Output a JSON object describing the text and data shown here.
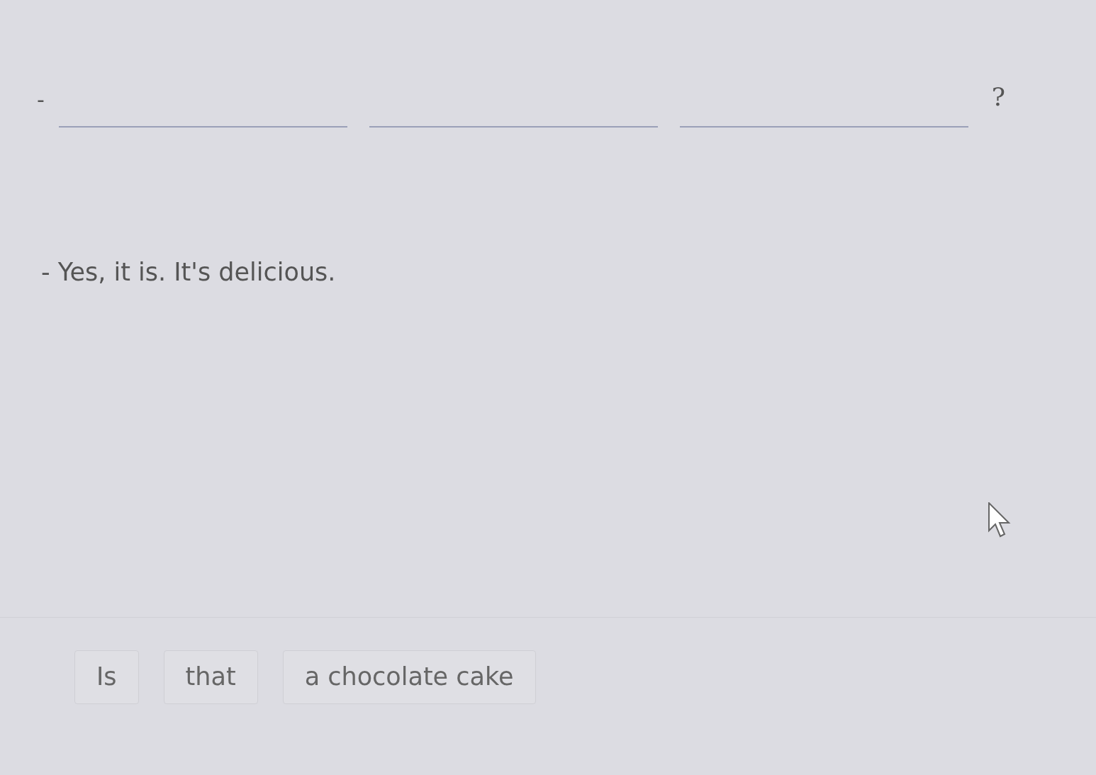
{
  "question": {
    "parts": [
      {
        "kind": "dash",
        "text": "-"
      },
      {
        "kind": "blank"
      },
      {
        "kind": "blank"
      },
      {
        "kind": "blank"
      },
      {
        "kind": "text",
        "text": "?"
      }
    ]
  },
  "answer": {
    "text": "- Yes, it is. It's delicious."
  },
  "word_bank": [
    {
      "text": "Is"
    },
    {
      "text": "that"
    },
    {
      "text": "a chocolate cake"
    }
  ]
}
